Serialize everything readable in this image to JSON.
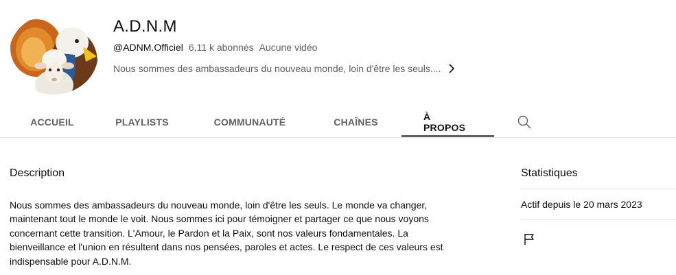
{
  "channel": {
    "name": "A.D.N.M",
    "handle": "@ADNM.Officiel",
    "subscribers": "6,11 k abonnés",
    "videos": "Aucune vidéo",
    "short_description": "Nous sommes des ambassadeurs du nouveau monde, loin d'être les seuls...."
  },
  "tabs": [
    {
      "label": "ACCUEIL"
    },
    {
      "label": "PLAYLISTS"
    },
    {
      "label": "COMMUNAUTÉ"
    },
    {
      "label": "CHAÎNES"
    },
    {
      "label": "À PROPOS"
    }
  ],
  "active_tab": "À PROPOS",
  "about": {
    "description_title": "Description",
    "description_text": "Nous sommes des ambassadeurs du nouveau monde, loin d'être les seuls. Le monde va changer, maintenant tout le monde le voit. Nous sommes ici pour témoigner et partager ce que nous voyons concernant cette transition. L'Amour, le Pardon et la Paix, sont nos valeurs fondamentales. La bienveillance et l'union en résultent dans nos pensées, paroles et actes. Le respect de ces valeurs est indispensable pour A.D.N.M."
  },
  "stats": {
    "title": "Statistiques",
    "active_since": "Actif depuis le 20 mars 2023"
  },
  "icons": {
    "search": "search-icon",
    "chevron": "chevron-right-icon",
    "flag": "flag-icon"
  },
  "colors": {
    "text_primary": "#0f0f0f",
    "text_secondary": "#606060",
    "divider": "#e5e5e5",
    "active_underline": "#606060"
  }
}
